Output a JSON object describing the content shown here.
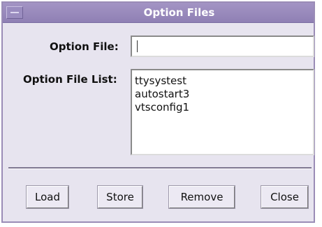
{
  "window": {
    "title": "Option Files"
  },
  "form": {
    "option_file_label": "Option File:",
    "option_file_value": "",
    "option_file_list_label": "Option File List:",
    "option_file_list": [
      "ttysystest",
      "autostart3",
      "vtsconfig1"
    ]
  },
  "buttons": {
    "load": "Load",
    "store": "Store",
    "remove": "Remove",
    "close": "Close"
  },
  "colors": {
    "titlebar": "#9586bb",
    "window_bg": "#e7e4ef",
    "field_bg": "#ffffff"
  }
}
